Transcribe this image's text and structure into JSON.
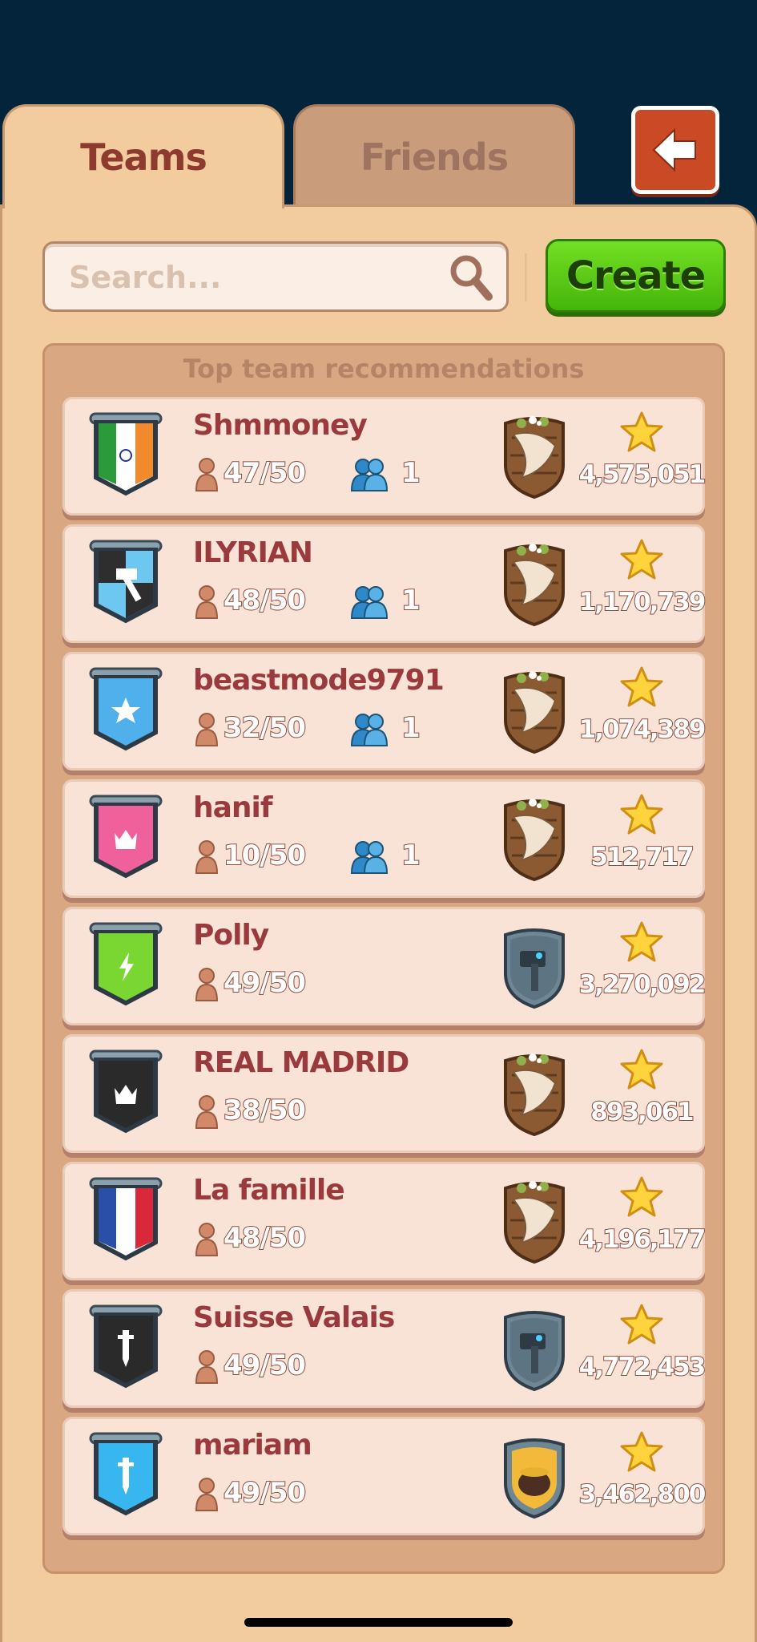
{
  "tabs": [
    {
      "label": "Teams",
      "active": true
    },
    {
      "label": "Friends",
      "active": false
    }
  ],
  "back_icon": "arrow-left-icon",
  "search": {
    "placeholder": "Search..."
  },
  "create_label": "Create",
  "list": {
    "heading": "Top team recommendations",
    "teams": [
      {
        "name": "Shmmoney",
        "members": "47/50",
        "friends": "1",
        "score": "4,575,051",
        "flag": "india",
        "trophy": "horn-shield"
      },
      {
        "name": "ILYRIAN",
        "members": "48/50",
        "friends": "1",
        "score": "1,170,739",
        "flag": "hammer-black-blue",
        "trophy": "horn-shield"
      },
      {
        "name": "beastmode9791",
        "members": "32/50",
        "friends": "1",
        "score": "1,074,389",
        "flag": "blue-star",
        "trophy": "horn-shield"
      },
      {
        "name": "hanif",
        "members": "10/50",
        "friends": "1",
        "score": "512,717",
        "flag": "pink-crown",
        "trophy": "horn-shield"
      },
      {
        "name": "Polly",
        "members": "49/50",
        "friends": "",
        "score": "3,270,092",
        "flag": "green-lightning",
        "trophy": "hammer-shield"
      },
      {
        "name": "REAL MADRID",
        "members": "38/50",
        "friends": "",
        "score": "893,061",
        "flag": "black-crown",
        "trophy": "horn-shield"
      },
      {
        "name": "La famille",
        "members": "48/50",
        "friends": "",
        "score": "4,196,177",
        "flag": "france",
        "trophy": "horn-shield"
      },
      {
        "name": "Suisse Valais",
        "members": "49/50",
        "friends": "",
        "score": "4,772,453",
        "flag": "black-sword",
        "trophy": "hammer-shield"
      },
      {
        "name": "mariam",
        "members": "49/50",
        "friends": "",
        "score": "3,462,800",
        "flag": "blue-sword",
        "trophy": "pot-shield"
      }
    ]
  },
  "colors": {
    "background": "#03243a",
    "panel": "#f2cb9e",
    "name_text": "#9a3a3d",
    "create_green": "#45b50a",
    "back_red": "#c94a25"
  }
}
